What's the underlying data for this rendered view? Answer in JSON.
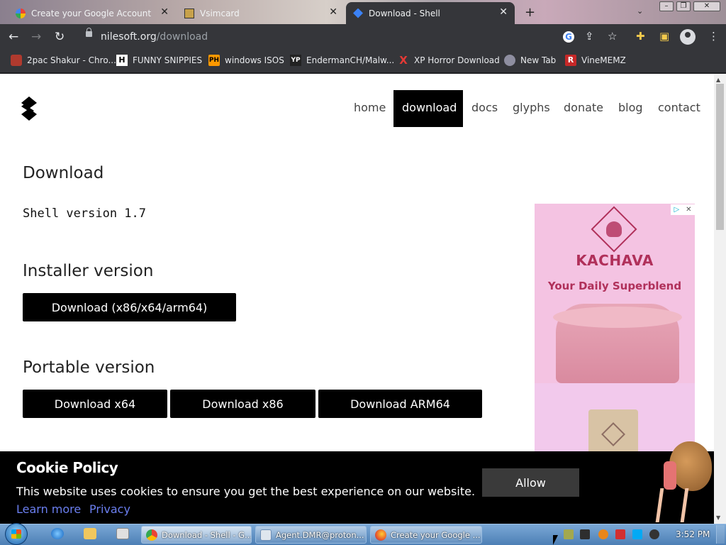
{
  "browser": {
    "tabs": [
      {
        "title": "Create your Google Account",
        "icon": "google-icon"
      },
      {
        "title": "Vsimcard",
        "icon": "simcard-icon"
      },
      {
        "title": "Download - Shell",
        "icon": "shell-icon",
        "active": true
      }
    ],
    "new_tab_label": "+",
    "url_host": "nilesoft.org",
    "url_path": "/download",
    "bookmarks": [
      {
        "label": "2pac Shakur - Chro...",
        "icon": "bookmark-2pac-icon"
      },
      {
        "label": "FUNNY SNIPPIES",
        "icon": "bookmark-h-icon",
        "icon_text": "H"
      },
      {
        "label": "windows ISOS",
        "icon": "bookmark-ph-icon",
        "icon_text": "PH"
      },
      {
        "label": "EndermanCH/Malw...",
        "icon": "bookmark-yp-icon",
        "icon_text": "YP"
      },
      {
        "label": "XP Horror Download",
        "icon": "bookmark-x-icon",
        "icon_text": "X"
      },
      {
        "label": "New Tab",
        "icon": "bookmark-newtab-icon"
      },
      {
        "label": "VineMEMZ",
        "icon": "bookmark-r-icon",
        "icon_text": "R"
      }
    ]
  },
  "site": {
    "nav": [
      "home",
      "download",
      "docs",
      "glyphs",
      "donate",
      "blog",
      "contact"
    ],
    "active_nav": "download",
    "heading": "Download",
    "version_text": "Shell version 1.7",
    "installer_heading": "Installer version",
    "installer_button": "Download (x86/x64/arm64)",
    "portable_heading": "Portable version",
    "portable_buttons": [
      "Download x64",
      "Download x86",
      "Download ARM64"
    ]
  },
  "ad": {
    "brand": "KACHAVA",
    "tagline": "Your Daily Superblend",
    "colors": {
      "brand": "#b0305a",
      "background": "#f4c3e2"
    }
  },
  "cookie": {
    "title": "Cookie Policy",
    "text": "This website uses cookies to ensure you get the best experience on our website.",
    "learn_more": "Learn more",
    "privacy": "Privacy",
    "allow": "Allow"
  },
  "taskbar": {
    "tasks": [
      {
        "label": "Download - Shell - G...",
        "icon": "chrome-icon",
        "active": true
      },
      {
        "label": "Agent.DMR@proton...",
        "icon": "window-icon"
      },
      {
        "label": "Create your Google ...",
        "icon": "firefox-icon"
      }
    ],
    "clock": "3:52 PM"
  }
}
